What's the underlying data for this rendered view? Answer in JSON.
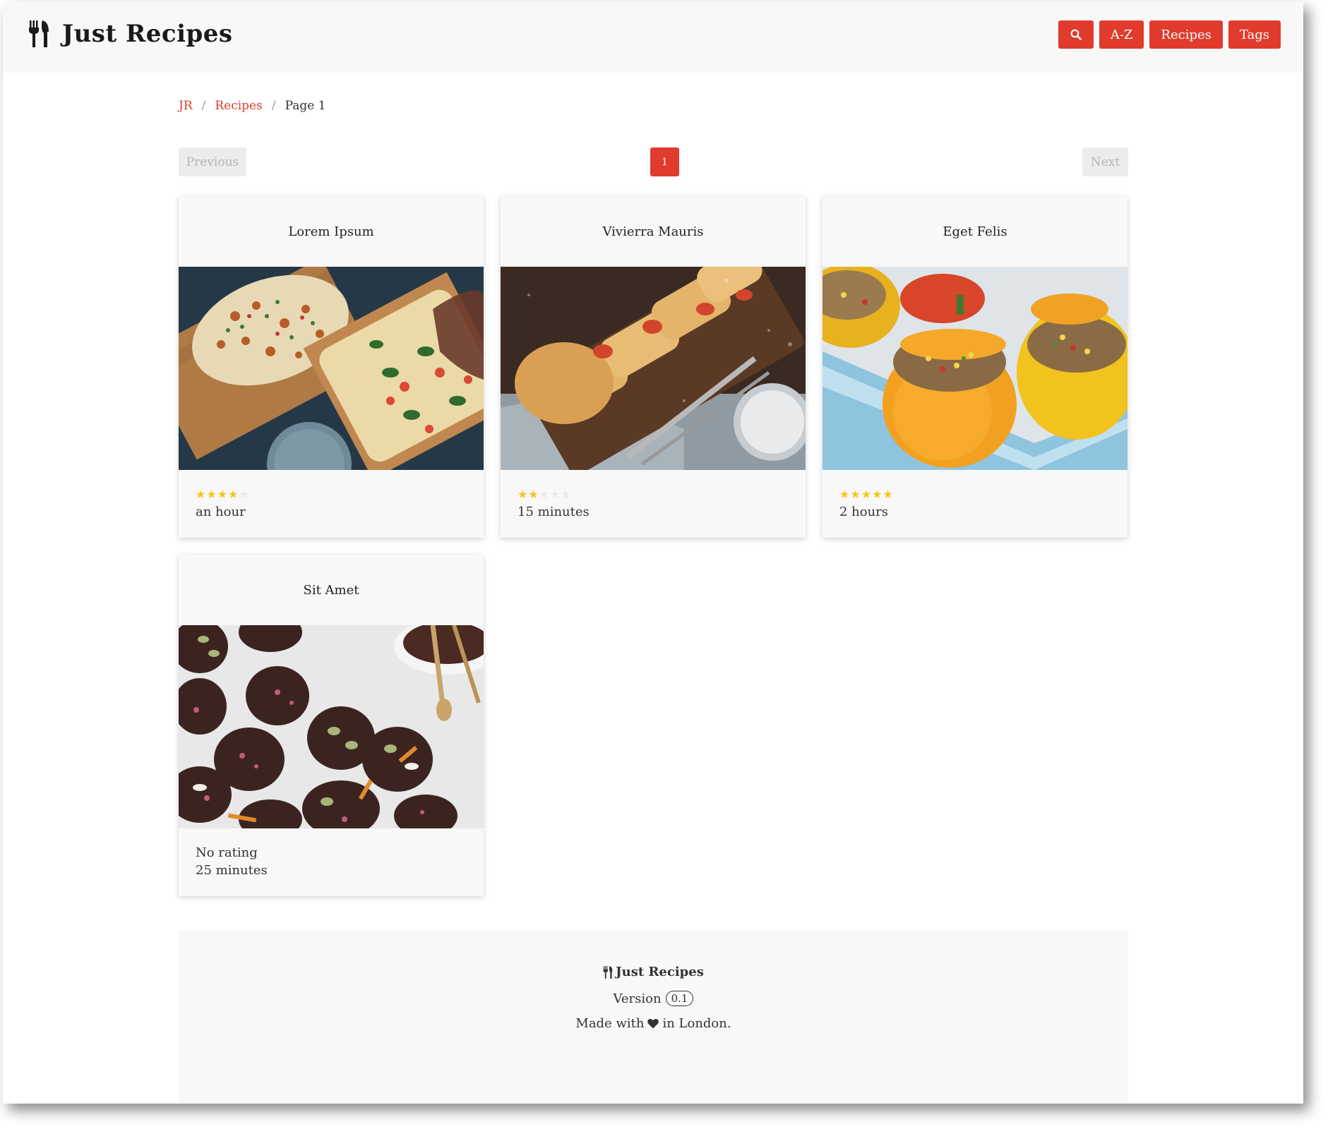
{
  "brand": {
    "name": "Just Recipes",
    "icon": "utensils-icon"
  },
  "nav": {
    "search_icon": "search-icon",
    "az_label": "A-Z",
    "recipes_label": "Recipes",
    "tags_label": "Tags"
  },
  "breadcrumb": [
    {
      "label": "JR"
    },
    {
      "label": "Recipes"
    },
    {
      "label": "Page 1"
    }
  ],
  "pagination": {
    "previous": "Previous",
    "next": "Next",
    "current_page": "1"
  },
  "recipes": [
    {
      "title": "Lorem Ipsum",
      "rating": 4,
      "max_rating": 5,
      "rating_text": "",
      "time": "an hour"
    },
    {
      "title": "Vivierra Mauris",
      "rating": 2,
      "max_rating": 5,
      "rating_text": "",
      "time": "15 minutes"
    },
    {
      "title": "Eget Felis",
      "rating": 5,
      "max_rating": 5,
      "rating_text": "",
      "time": "2 hours"
    },
    {
      "title": "Sit Amet",
      "rating": 0,
      "max_rating": 5,
      "rating_text": "No rating",
      "time": "25 minutes"
    }
  ],
  "footer": {
    "brand": "Just Recipes",
    "version_label": "Version",
    "version": "0.1",
    "made_prefix": "Made with",
    "made_suffix": "in London."
  },
  "colors": {
    "accent": "#e03b2c",
    "star": "#f5c518",
    "panel": "#f8f8f8"
  }
}
